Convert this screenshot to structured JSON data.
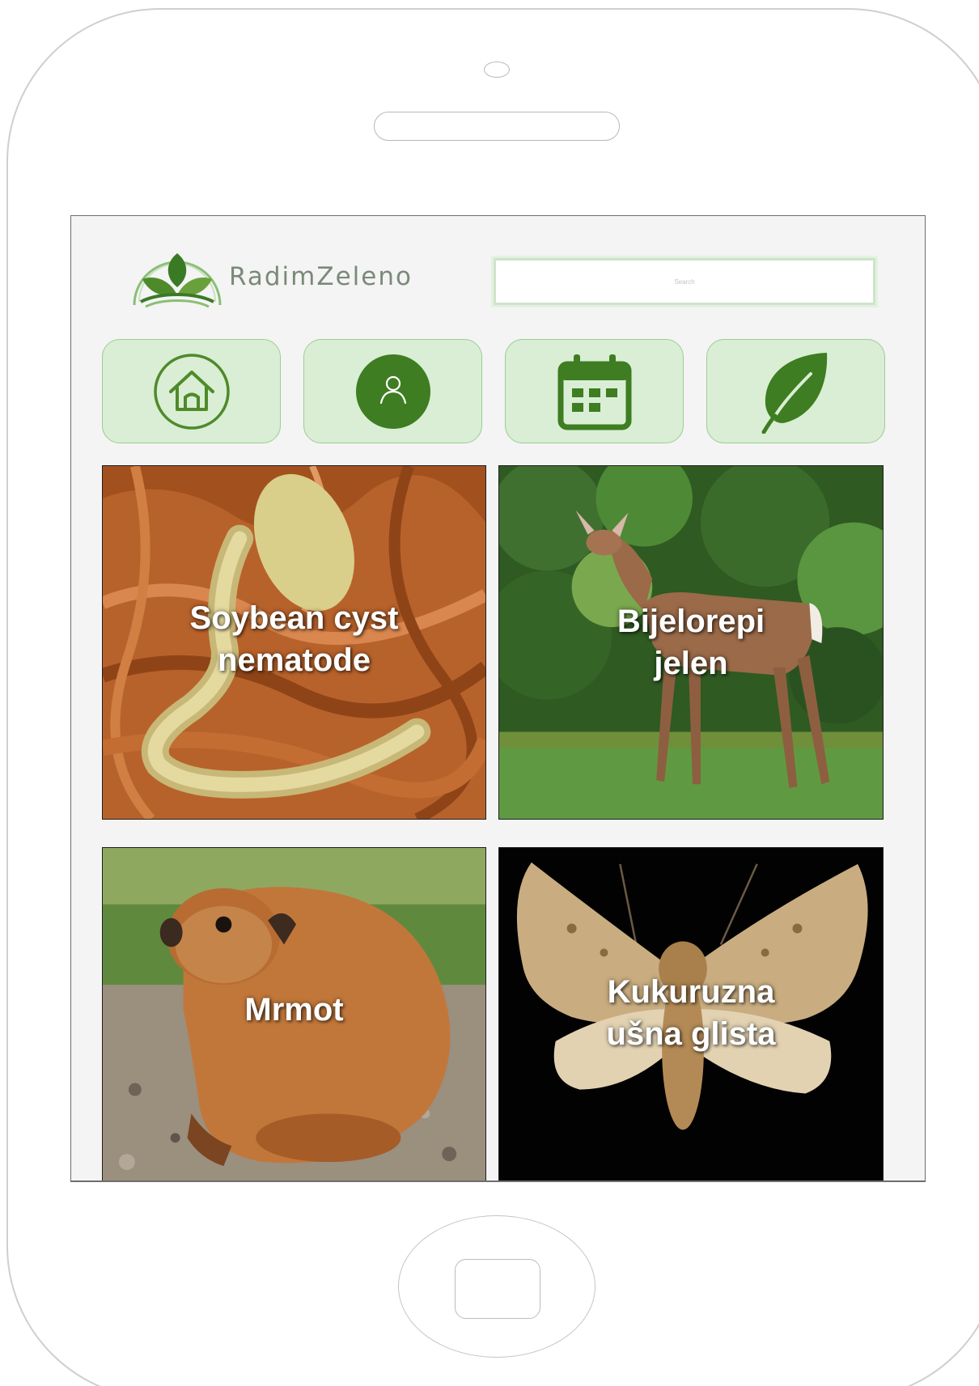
{
  "app": {
    "name": "RadimZeleno"
  },
  "search": {
    "placeholder": "Search",
    "value": ""
  },
  "nav": [
    {
      "id": "home",
      "icon": "home-icon"
    },
    {
      "id": "profile",
      "icon": "user-icon"
    },
    {
      "id": "calendar",
      "icon": "calendar-icon"
    },
    {
      "id": "plants",
      "icon": "leaf-icon"
    }
  ],
  "cards": [
    {
      "title": "Soybean cyst\nnematode",
      "image": "nematode-micrograph"
    },
    {
      "title": "Bijelorepi\njelen",
      "image": "white-tailed-deer"
    },
    {
      "title": "Mrmot",
      "image": "groundhog"
    },
    {
      "title": "Kukuruzna\nušna glista",
      "image": "corn-earworm-moth"
    }
  ],
  "colors": {
    "accent": "#4f8a2a",
    "nav_bg": "#d9eed5",
    "nav_border": "#9fcb97",
    "screen_bg": "#f4f4f4"
  }
}
